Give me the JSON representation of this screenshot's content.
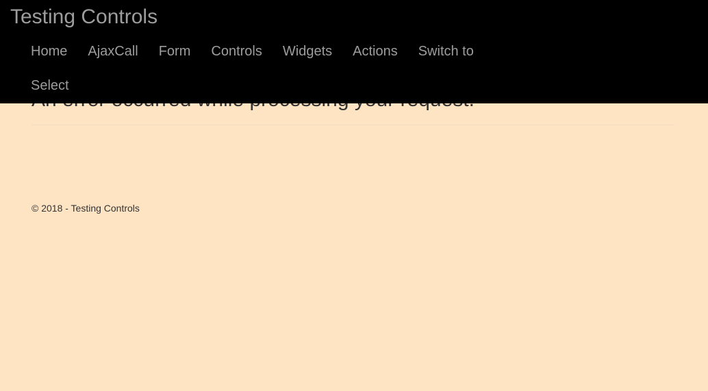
{
  "navbar": {
    "brand": "Testing Controls",
    "items": [
      {
        "label": "Home"
      },
      {
        "label": "AjaxCall"
      },
      {
        "label": "Form"
      },
      {
        "label": "Controls"
      },
      {
        "label": "Widgets"
      },
      {
        "label": "Actions"
      },
      {
        "label": "Switch to"
      },
      {
        "label": "Select"
      }
    ]
  },
  "main": {
    "error_title": "An error occurred while processing your request."
  },
  "footer": {
    "text": "© 2018 - Testing Controls"
  },
  "colors": {
    "background": "#ffe4c4",
    "navbar": "#000000",
    "nav_text": "#9d9d9d",
    "body_text": "#333333"
  }
}
